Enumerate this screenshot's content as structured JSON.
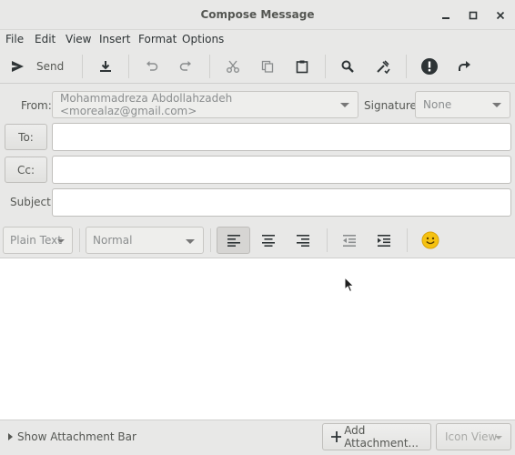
{
  "window": {
    "title": "Compose Message",
    "controls": [
      "minimize",
      "maximize",
      "close"
    ]
  },
  "menubar": {
    "items": [
      "File",
      "Edit",
      "View",
      "Insert",
      "Format",
      "Options"
    ]
  },
  "toolbar": {
    "send_label": "Send",
    "icons": [
      "send-icon",
      "save-draft-icon",
      "undo-icon",
      "redo-icon",
      "cut-icon",
      "copy-icon",
      "paste-icon",
      "find-icon",
      "spell-check-icon",
      "priority-icon",
      "forward-icon"
    ]
  },
  "header": {
    "from_label": "From:",
    "from_value": "Mohammadreza Abdollahzadeh <morealaz@gmail.com>",
    "signature_label": "Signature:",
    "signature_value": "None",
    "to_label": "To:",
    "cc_label": "Cc:",
    "subject_label": "Subject:",
    "to_value": "",
    "cc_value": "",
    "subject_value": ""
  },
  "format": {
    "mode": "Plain Text",
    "paragraph_style": "Normal",
    "alignment": "left"
  },
  "bottom": {
    "show_attachment_bar": "Show Attachment Bar",
    "add_attachment": "Add Attachment...",
    "view_mode": "Icon View"
  },
  "colors": {
    "priority": "#2e3436",
    "emoji": "#f5c211",
    "background": "#e8e8e7"
  }
}
